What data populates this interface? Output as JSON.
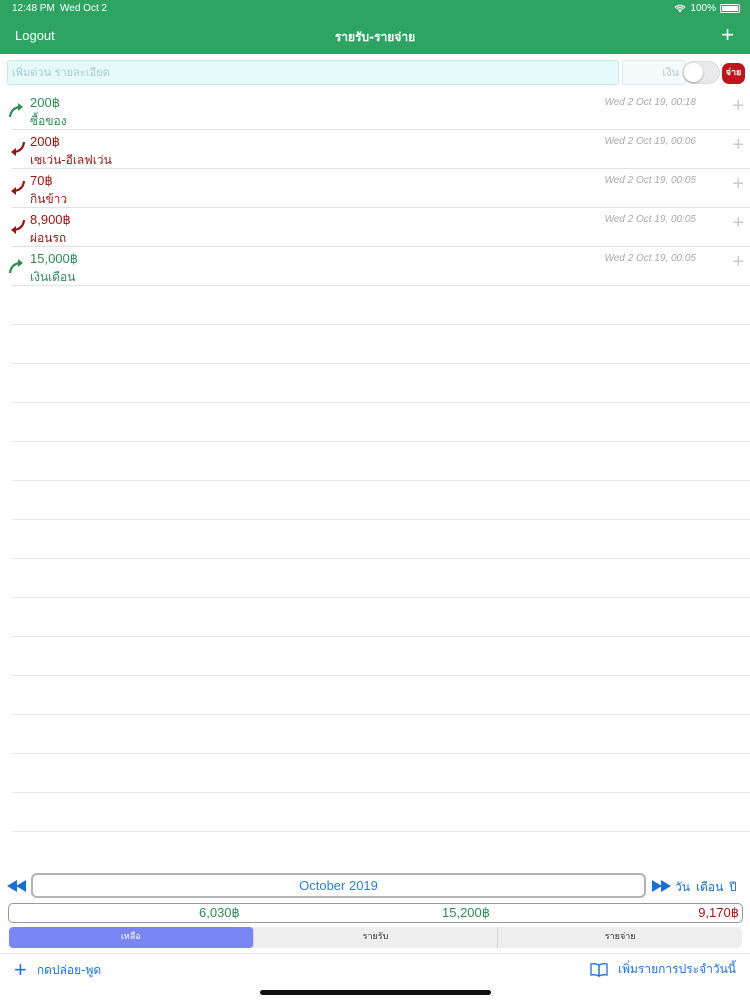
{
  "status": {
    "time": "12:48 PM",
    "date": "Wed Oct 2",
    "battery": "100%"
  },
  "nav": {
    "logout": "Logout",
    "title": "รายรับ-รายจ่าย",
    "add": "+"
  },
  "entry": {
    "desc_placeholder": "เพิ่มด่วน รายละเอียด",
    "amount_placeholder": "เงิน",
    "type_label": "จ่าย"
  },
  "transactions": [
    {
      "kind": "income",
      "amount": "200฿",
      "note": "ซื้อของ",
      "time": "Wed 2 Oct 19, 00:18"
    },
    {
      "kind": "expense",
      "amount": "200฿",
      "note": "เซเว่น-อีเลฟเว่น",
      "time": "Wed 2 Oct 19, 00:06"
    },
    {
      "kind": "expense",
      "amount": "70฿",
      "note": "กินข้าว",
      "time": "Wed 2 Oct 19, 00:05"
    },
    {
      "kind": "expense",
      "amount": "8,900฿",
      "note": "ผ่อนรถ",
      "time": "Wed 2 Oct 19, 00:05"
    },
    {
      "kind": "income",
      "amount": "15,000฿",
      "note": "เงินเดือน",
      "time": "Wed 2 Oct 19, 00:05"
    }
  ],
  "period": {
    "month": "October 2019",
    "day": "วัน",
    "month_label": "เดือน",
    "year": "ปี"
  },
  "totals": {
    "balance": "6,030฿",
    "income": "15,200฿",
    "expense": "9,170฿"
  },
  "tabs": [
    "เหลือ",
    "รายรับ",
    "รายจ่าย"
  ],
  "toolbar": {
    "voice": "กดปล่อย-พูด",
    "recurring": "เพิ่มรายการประจำวันนี้"
  },
  "colors": {
    "header": "#2ea463",
    "income": "#2e8b57",
    "expense": "#9b1414",
    "accent": "#1a73e8",
    "active_tab": "#7b86f5"
  }
}
